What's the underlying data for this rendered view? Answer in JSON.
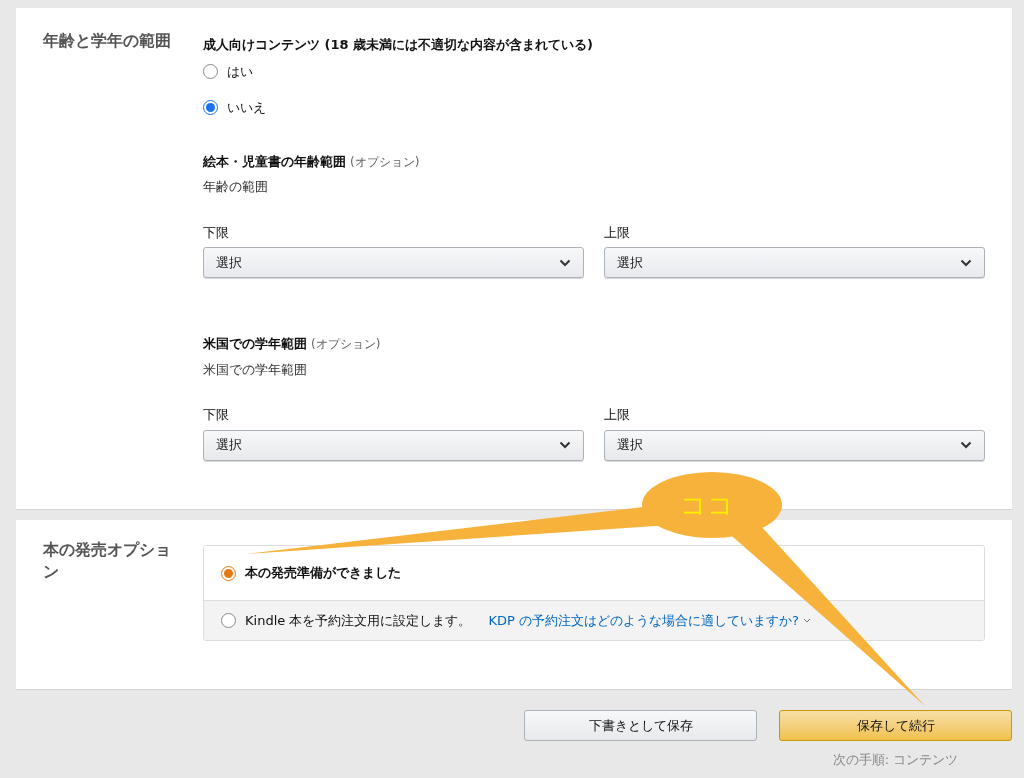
{
  "age_section": {
    "heading": "年齢と学年の範囲",
    "adult": {
      "label": "成人向けコンテンツ (18 歳未満には不適切な内容が含まれている)",
      "options": [
        {
          "label": "はい",
          "selected": false
        },
        {
          "label": "いいえ",
          "selected": true
        }
      ]
    },
    "ranges": [
      {
        "title": "絵本・児童書の年齢範囲",
        "optional": "(オプション)",
        "subtitle": "年齢の範囲",
        "fields": [
          {
            "label": "下限",
            "value": "選択"
          },
          {
            "label": "上限",
            "value": "選択"
          }
        ]
      },
      {
        "title": "米国での学年範囲",
        "optional": "(オプション)",
        "subtitle": "米国での学年範囲",
        "fields": [
          {
            "label": "下限",
            "value": "選択"
          },
          {
            "label": "上限",
            "value": "選択"
          }
        ]
      }
    ]
  },
  "release": {
    "heading": "本の発売オプション",
    "options": [
      {
        "label": "本の発売準備ができました",
        "selected": true
      },
      {
        "label": "Kindle 本を予約注文用に設定します。",
        "link": "KDP の予約注文はどのような場合に適していますか?",
        "selected": false
      }
    ]
  },
  "buttons": [
    {
      "label": "下書きとして保存",
      "kind": "secondary"
    },
    {
      "label": "保存して続行",
      "kind": "primary"
    }
  ],
  "next_step": "次の手順: コンテンツ",
  "annotation": {
    "text": "ココ"
  }
}
